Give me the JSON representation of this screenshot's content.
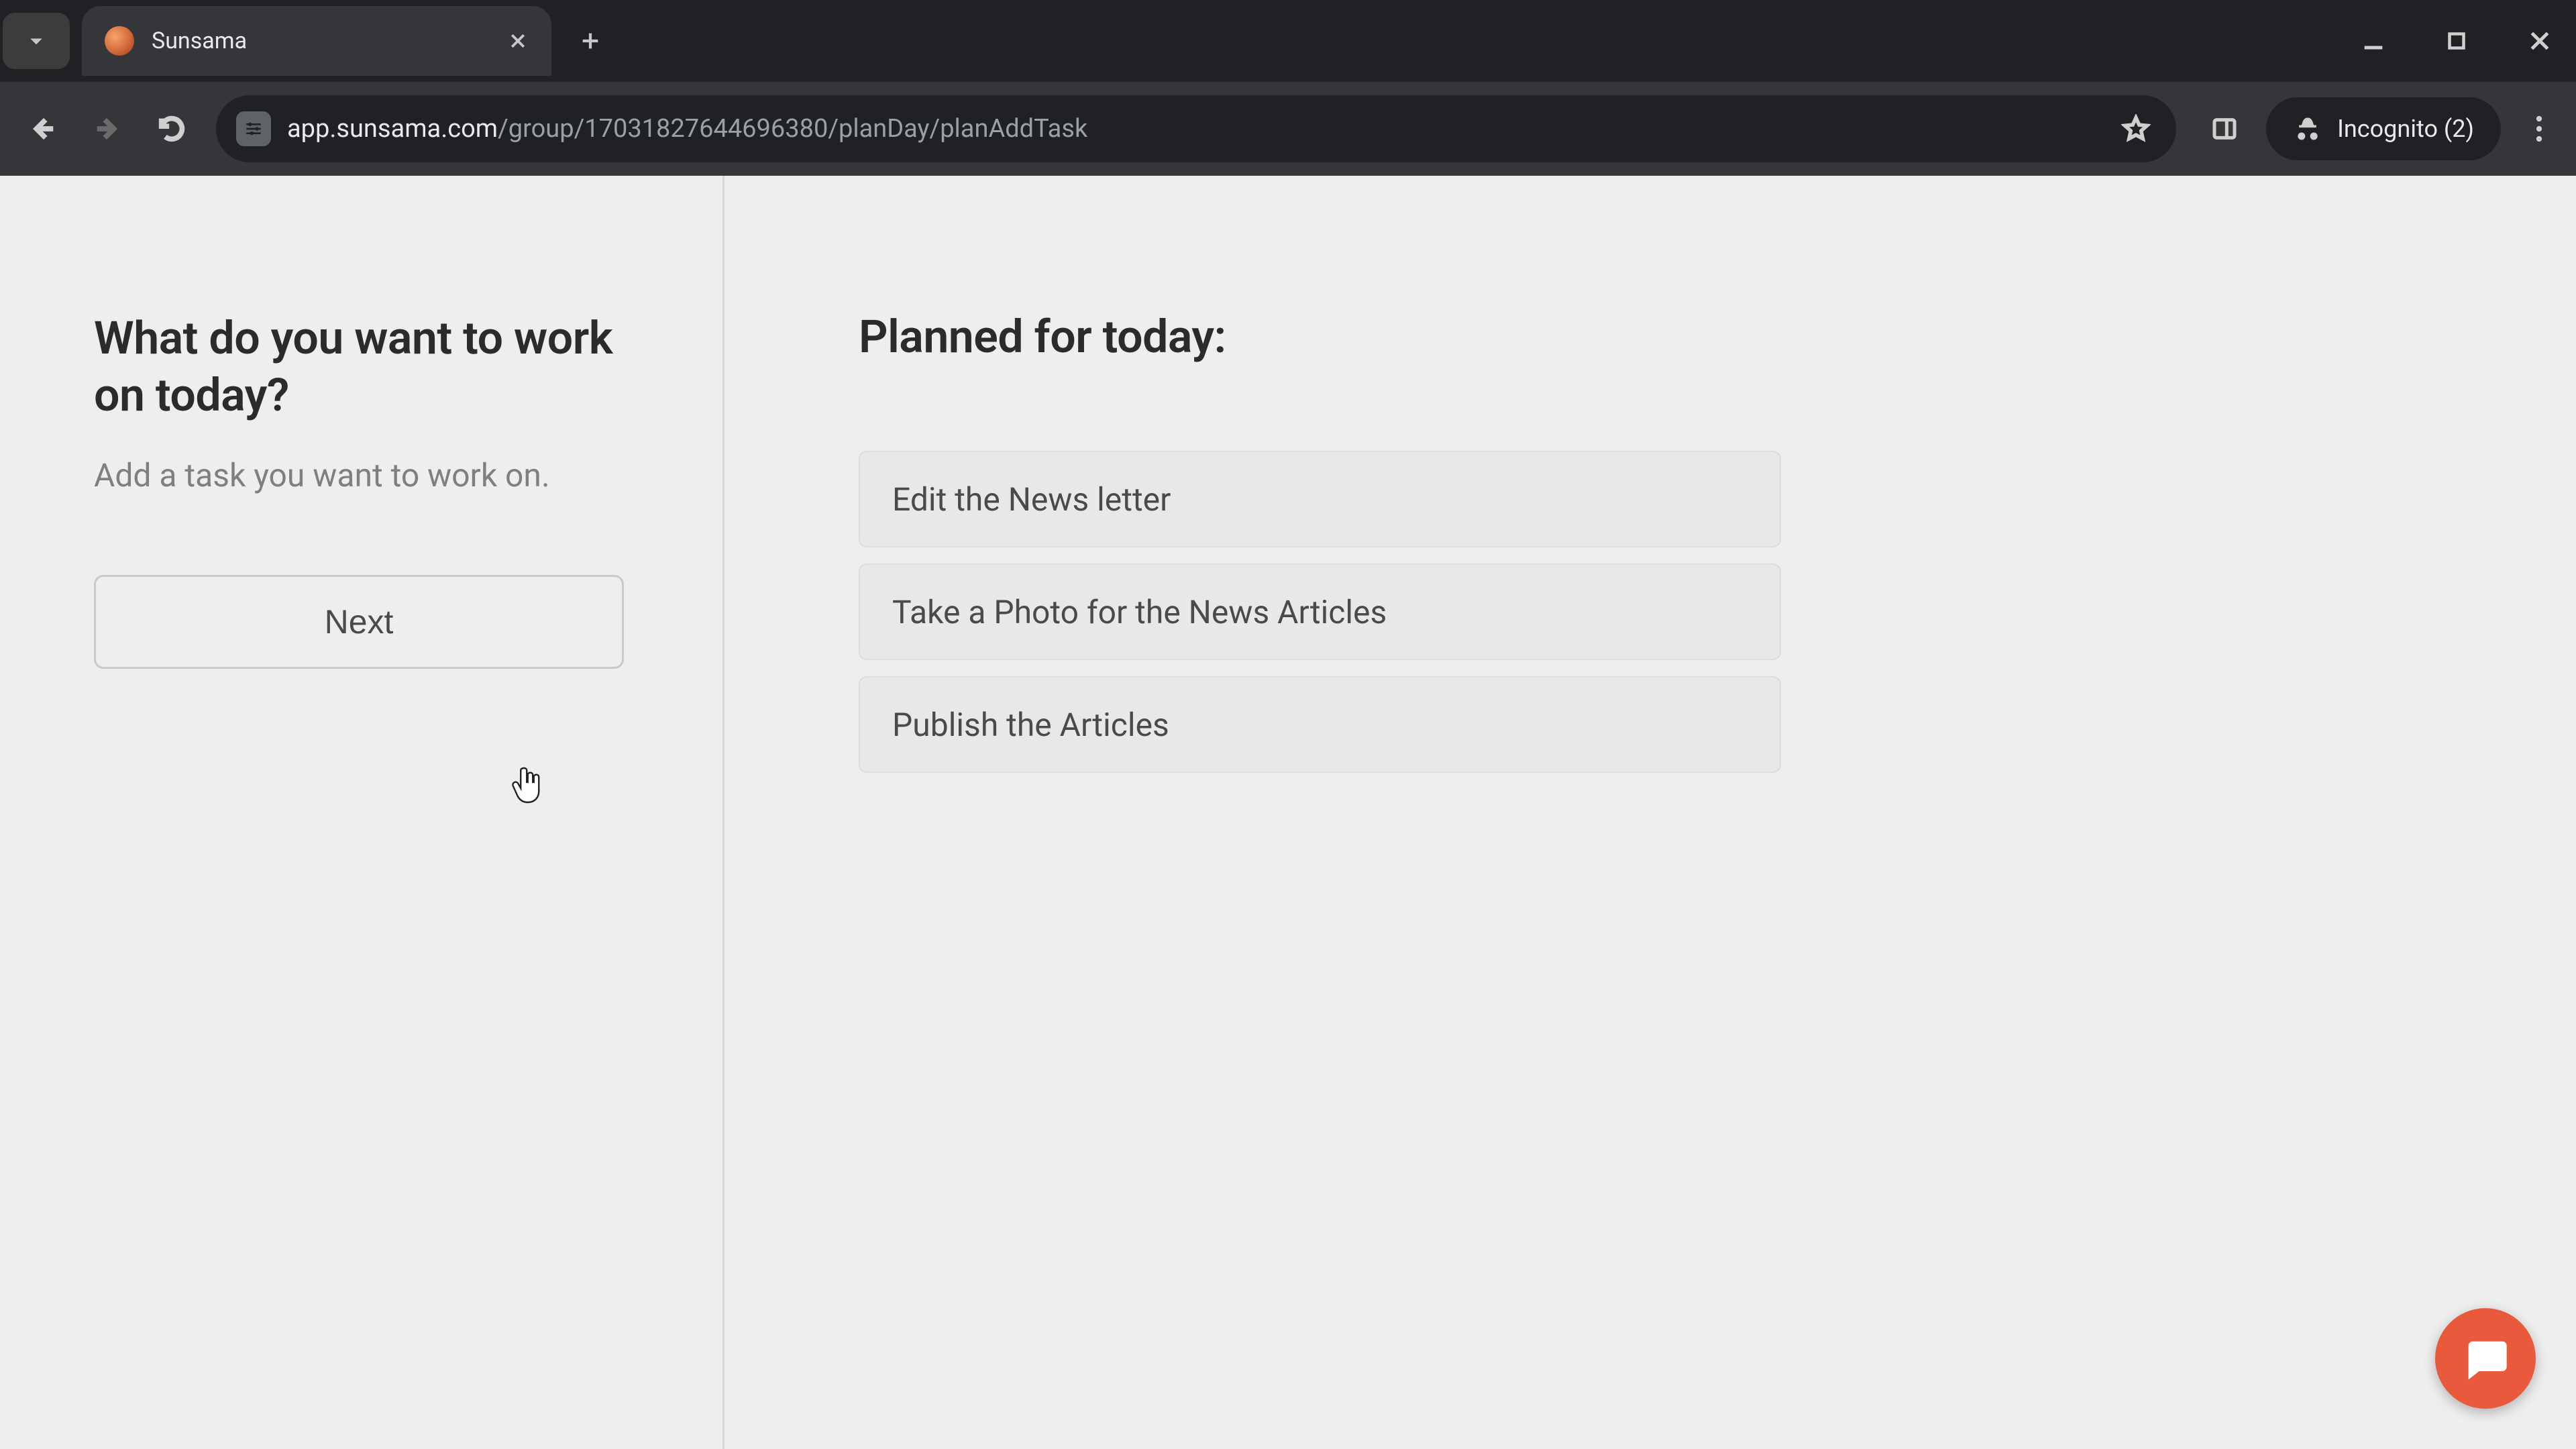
{
  "browser": {
    "tab_title": "Sunsama",
    "url_domain": "app.sunsama.com",
    "url_path": "/group/17031827644696380/planDay/planAddTask",
    "incognito_label": "Incognito (2)"
  },
  "left": {
    "title": "What do you want to work on today?",
    "subtitle": "Add a task you want to work on.",
    "next_label": "Next"
  },
  "right": {
    "title": "Planned for today:",
    "tasks": [
      "Edit the News letter",
      "Take a Photo for the News Articles",
      "Publish the Articles"
    ]
  }
}
